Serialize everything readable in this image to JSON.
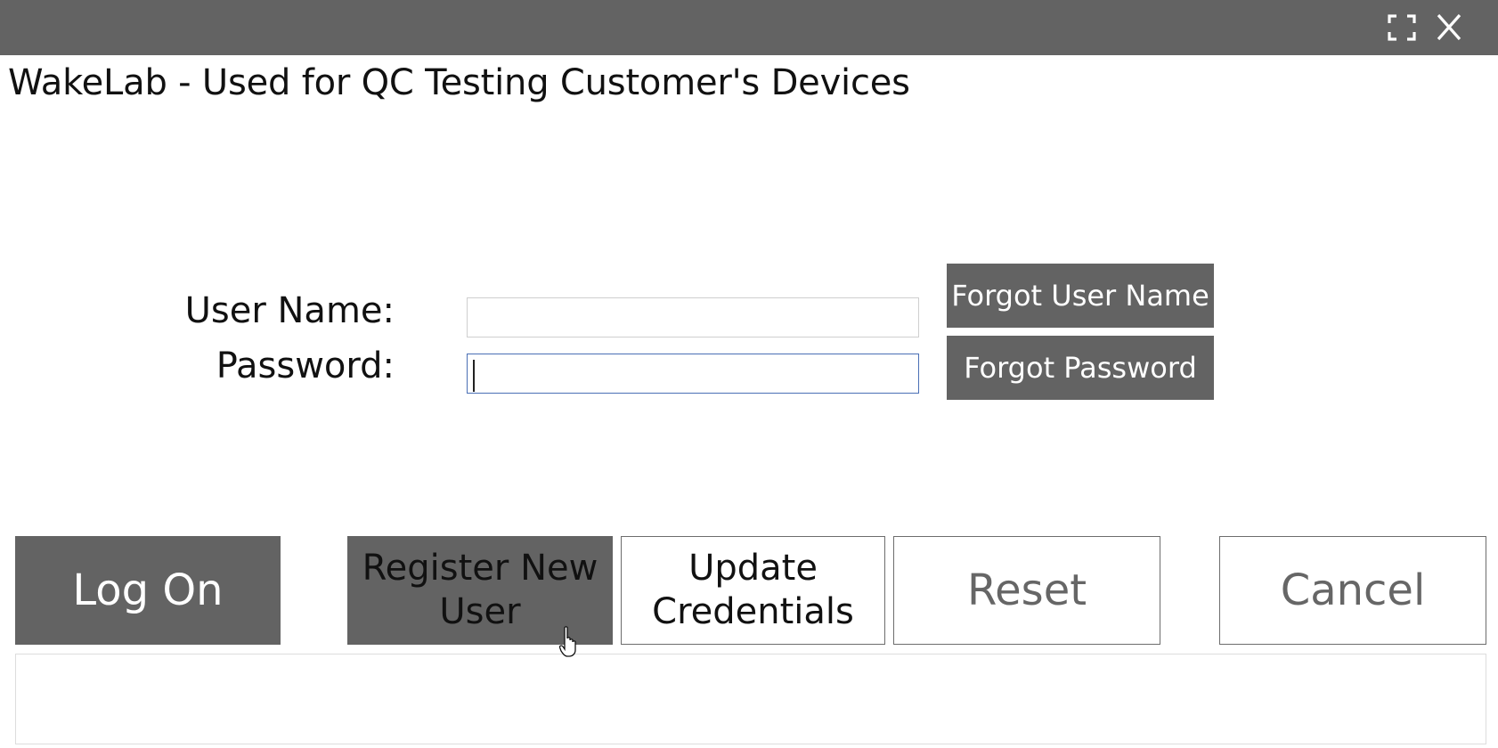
{
  "window": {
    "title": "WakeLab - Used for QC Testing Customer's Devices",
    "titlebar_color": "#636363",
    "maximize_icon": "maximize-icon",
    "close_icon": "close-icon"
  },
  "form": {
    "username_label": "User Name:",
    "username_value": "",
    "password_label": "Password:",
    "password_value": "",
    "focused_field": "password"
  },
  "side_buttons": {
    "forgot_username": "Forgot User Name",
    "forgot_password": "Forgot Password"
  },
  "action_buttons": {
    "log_on": "Log On",
    "register": "Register New\nUser",
    "update": "Update\nCredentials",
    "reset": "Reset",
    "cancel": "Cancel"
  },
  "message": {
    "text": ""
  },
  "colors": {
    "button_dark": "#636363",
    "focus_border": "#4a6fb5",
    "disabled_text": "#666666"
  }
}
